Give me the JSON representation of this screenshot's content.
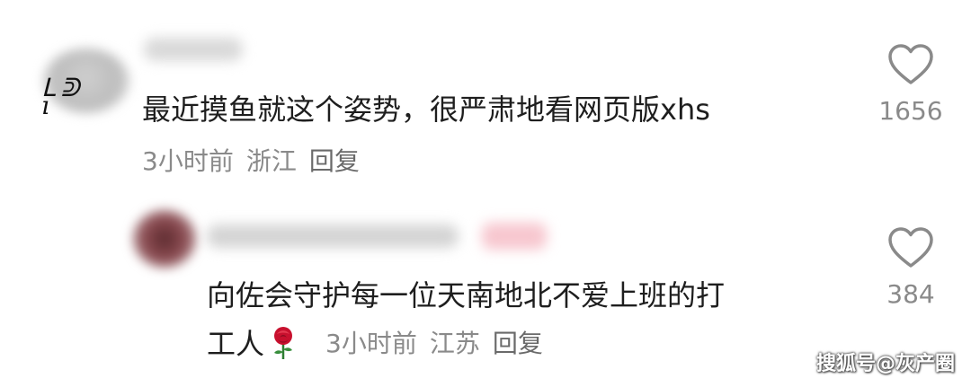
{
  "comments": [
    {
      "text": "最近摸鱼就这个姿势，很严肃地看网页版xhs",
      "time": "3小时前",
      "location": "浙江",
      "reply_label": "回复",
      "likes": "1656"
    },
    {
      "text_line1": "向佐会守护每一位天南地北不爱上班的打",
      "text_line2": "工人",
      "emoji": "rose-icon",
      "time": "3小时前",
      "location": "江苏",
      "reply_label": "回复",
      "likes": "384"
    }
  ],
  "avatar_mark": "ᒪᕲ ı",
  "watermark": "搜狐号@灰产圈",
  "colors": {
    "text": "#1e1e1e",
    "meta": "#8a8a8a",
    "heart_outline": "#8a8a8a",
    "rose": "#c8102e"
  }
}
